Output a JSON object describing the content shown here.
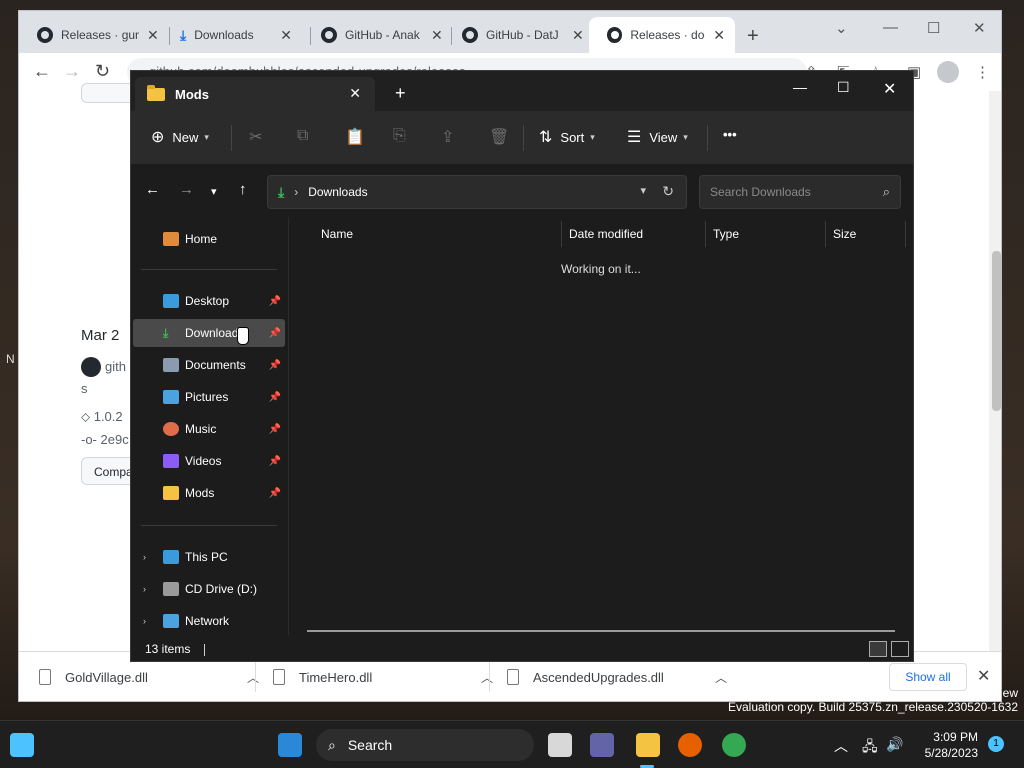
{
  "browser": {
    "tabs": [
      {
        "label": "Releases · gum",
        "icon": "github-icon"
      },
      {
        "label": "Downloads",
        "icon": "download-icon"
      },
      {
        "label": "GitHub - Anak",
        "icon": "github-icon"
      },
      {
        "label": "GitHub - DatJ",
        "icon": "github-icon"
      },
      {
        "label": "Releases · doo",
        "icon": "github-icon",
        "active": true
      }
    ],
    "url": "github.com/doombubbles/ascended-upgrades/releases",
    "page": {
      "date": "Mar 2",
      "author": "gith",
      "line_s": "s",
      "tag": "1.0.2",
      "commit": "2e9c",
      "compare_label": "Compa"
    },
    "downloads_bar": {
      "items": [
        "GoldVillage.dll",
        "TimeHero.dll",
        "AscendedUpgrades.dll"
      ],
      "show_all": "Show all"
    }
  },
  "explorer": {
    "tab_title": "Mods",
    "commands": {
      "new": "New",
      "sort": "Sort",
      "view": "View",
      "more": "•••"
    },
    "address": {
      "current": "Downloads"
    },
    "search_placeholder": "Search Downloads",
    "sidebar": {
      "home": "Home",
      "quick_access": [
        "Desktop",
        "Downloads",
        "Documents",
        "Pictures",
        "Music",
        "Videos",
        "Mods"
      ],
      "this_pc": "This PC",
      "cd_drive": "CD Drive (D:)",
      "network": "Network"
    },
    "columns": [
      "Name",
      "Date modified",
      "Type",
      "Size"
    ],
    "loading_text": "Working on it...",
    "status": "13 items"
  },
  "desktop": {
    "peek_left": "N",
    "peek_right": "ew",
    "watermark": "Evaluation copy. Build 25375.zn_release.230520-1632"
  },
  "taskbar": {
    "search_label": "Search",
    "time": "3:09 PM",
    "date": "5/28/2023",
    "notification_count": "1"
  },
  "colors": {
    "explorer_bg": "#1c1c1c",
    "accent": "#4cc2ff",
    "chrome_blue": "#1a73e8"
  }
}
